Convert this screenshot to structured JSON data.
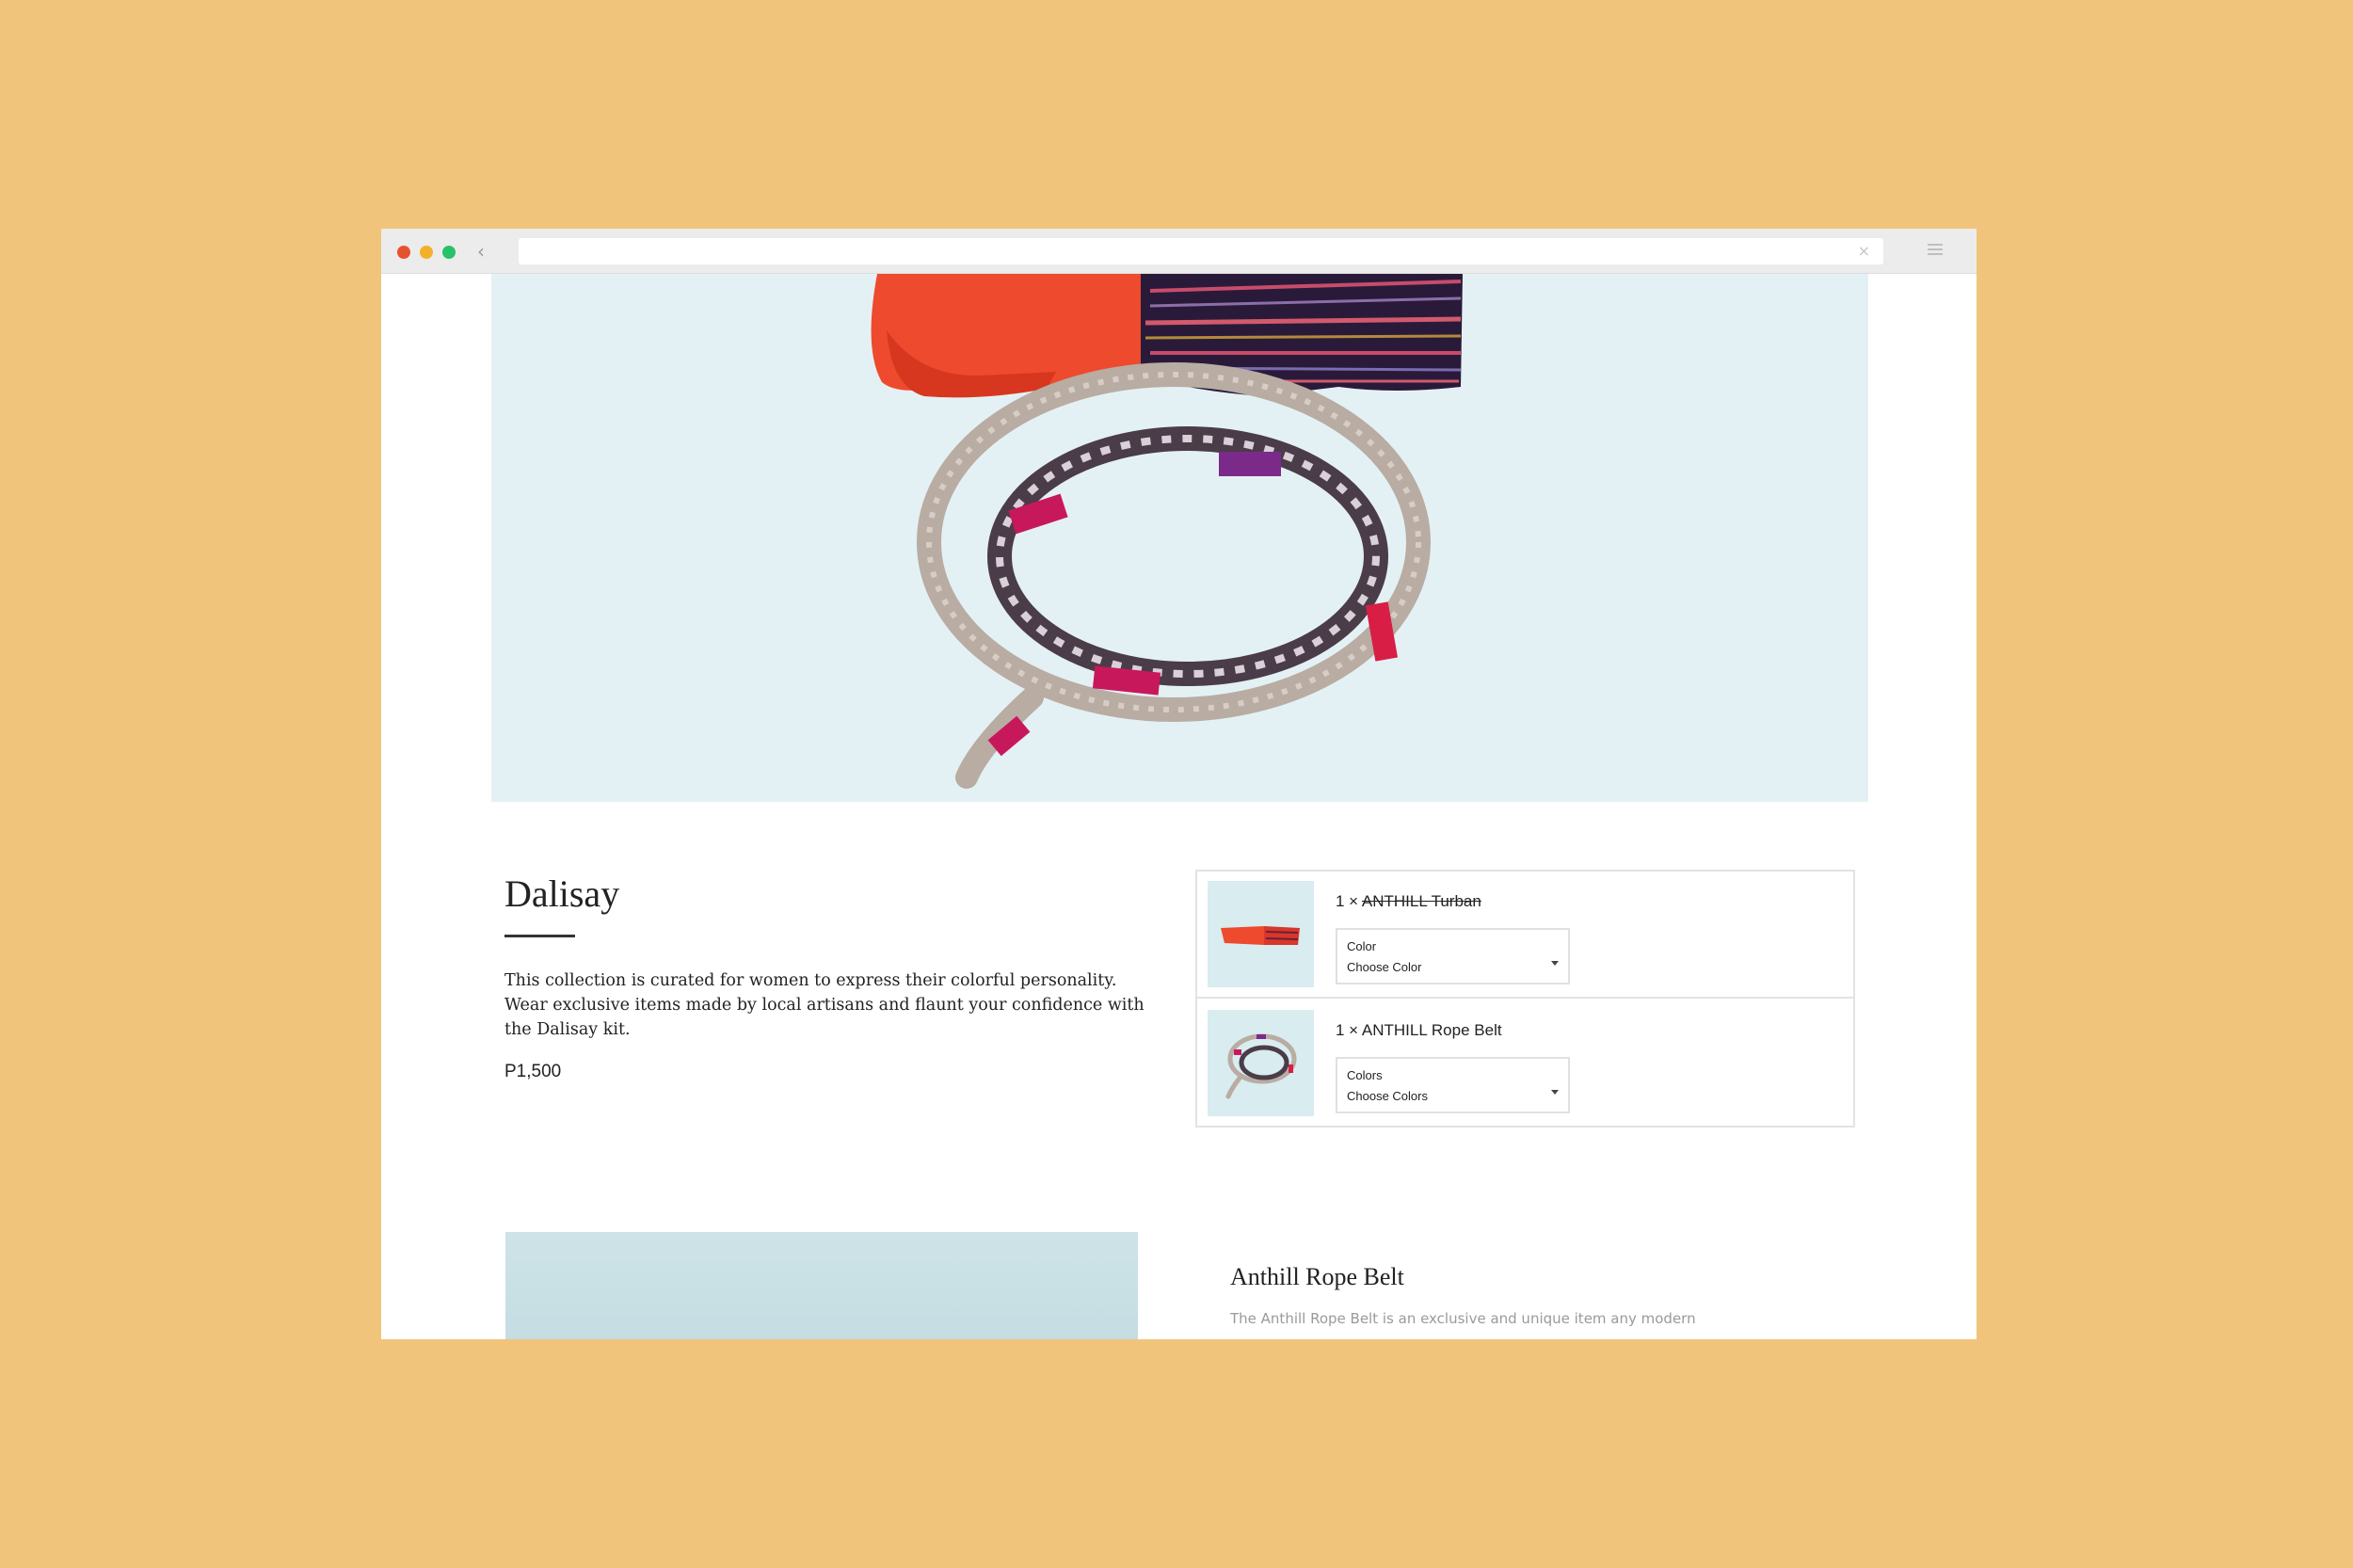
{
  "browser": {
    "url": "",
    "clear_glyph": "×",
    "back_glyph": "‹"
  },
  "kit": {
    "title": "Dalisay",
    "description": "This collection is curated for women to express their colorful personality. Wear exclusive items made by local artisans and flaunt your confidence with the Dalisay kit.",
    "price": "P1,500"
  },
  "kit_items": [
    {
      "quantity": "1 ×",
      "name": "ANTHILL Turban",
      "option_label": "Color",
      "option_value": "Choose Color"
    },
    {
      "quantity": "1 ×",
      "name": "ANTHILL Rope Belt",
      "option_label": "Colors",
      "option_value": "Choose Colors"
    }
  ],
  "product_section": {
    "title": "Anthill Rope Belt",
    "description": "The Anthill Rope Belt is an exclusive and unique item any modern"
  },
  "colors": {
    "page_background": "#f1c47b",
    "hero_background": "#e4f1f4",
    "turban_orange": "#ee4a2e",
    "rope_gray": "#b8aca3",
    "accent_magenta": "#c8185c"
  }
}
